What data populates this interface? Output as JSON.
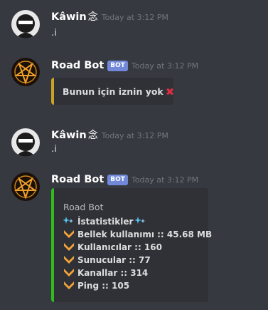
{
  "messages": [
    {
      "username": "Kâwin",
      "ornament": "念",
      "timestamp": "Today at 3:12 PM",
      "text": ".i"
    },
    {
      "username": "Road Bot",
      "bot_tag": "BOT",
      "timestamp": "Today at 3:12 PM",
      "embed": {
        "description": "Bunun için iznin yok",
        "accent_color": "#c9a227",
        "icon": "cross-mark-icon"
      }
    },
    {
      "username": "Kâwin",
      "ornament": "念",
      "timestamp": "Today at 3:12 PM",
      "text": ".i"
    },
    {
      "username": "Road Bot",
      "bot_tag": "BOT",
      "timestamp": "Today at 3:12 PM",
      "embed": {
        "author": "Road Bot",
        "accent_color": "#2dbe1e",
        "title": "İstatistikler",
        "title_icon": "sparkle-blue-icon",
        "lines": [
          "Bellek kullanımı :: 45.68 MB",
          "Kullanıcılar :: 160",
          "Sunucular :: 77",
          "Kanallar :: 314",
          "Ping :: 105"
        ],
        "line_icon": "orange-chevron-icon"
      }
    }
  ],
  "colors": {
    "background": "#36393f",
    "embed_background": "#2f3136",
    "bot_tag": "#7289da",
    "timestamp": "#72767d"
  }
}
